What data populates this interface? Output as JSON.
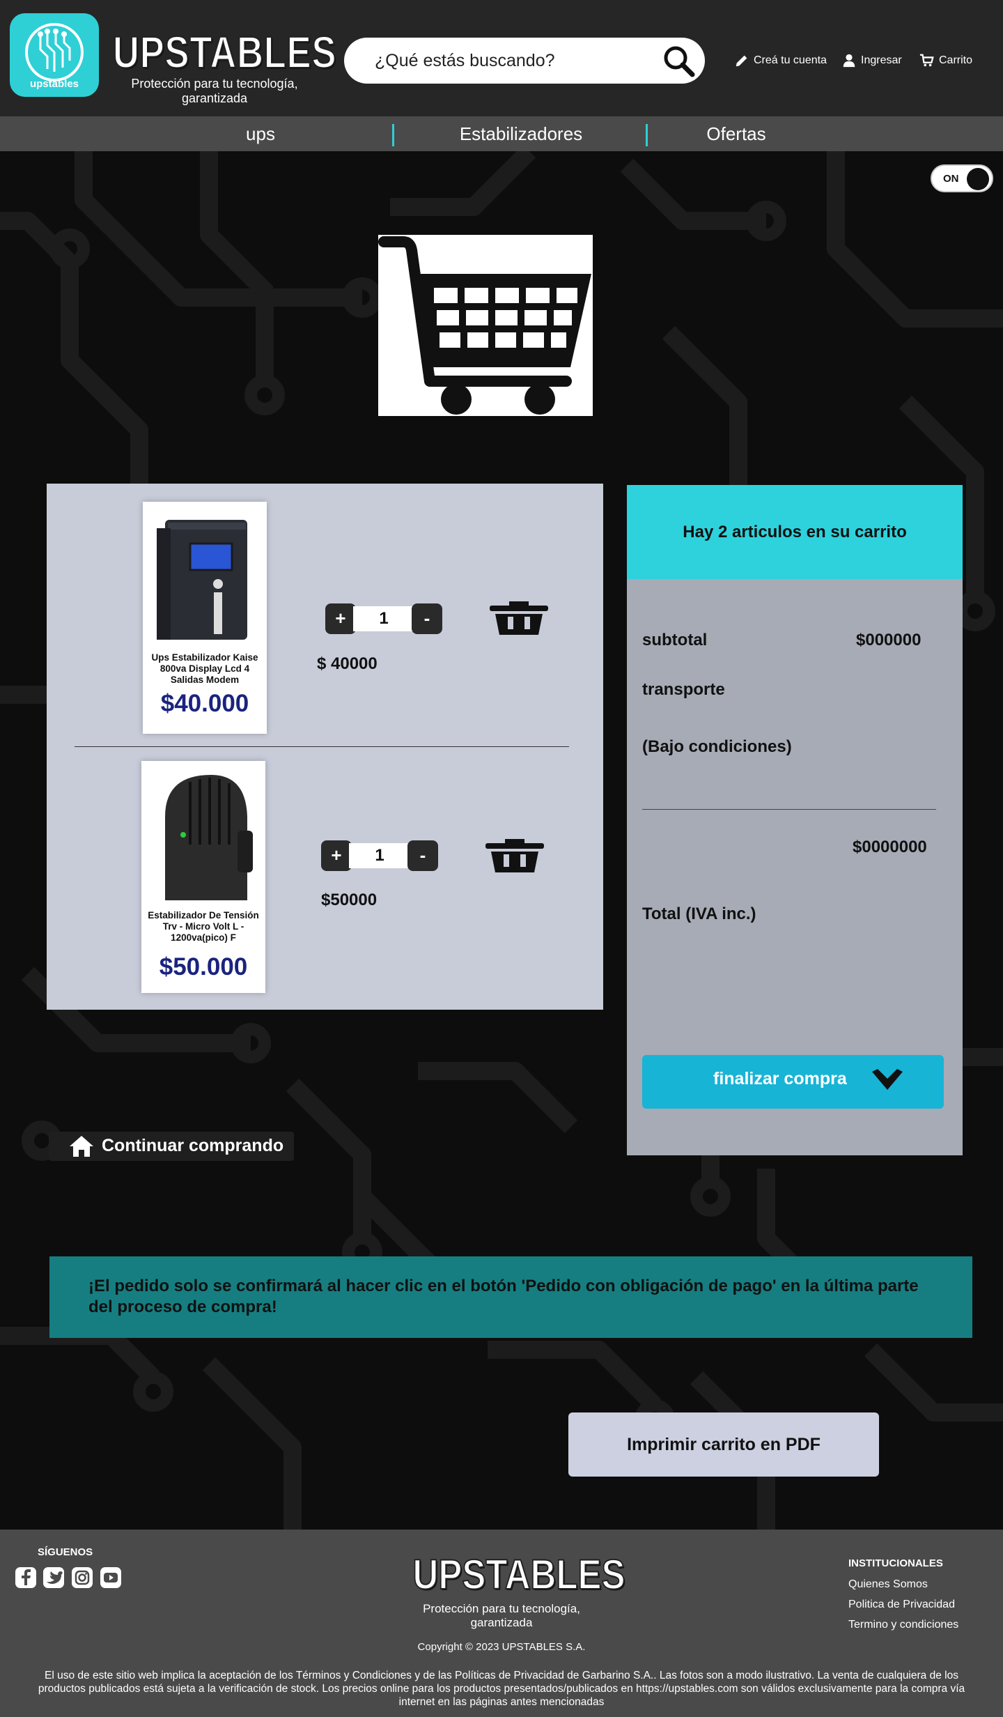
{
  "header": {
    "logo_badge_text": "upstables",
    "brand_name": "UPSTABLES",
    "tagline": "Protección para tu tecnología, garantizada",
    "search_placeholder": "¿Qué estás buscando?",
    "links": {
      "create_account": "Creá tu cuenta",
      "login": "Ingresar",
      "cart": "Carrito"
    }
  },
  "nav": {
    "items": [
      "ups",
      "Estabilizadores",
      "Ofertas"
    ]
  },
  "toggle": {
    "label": "ON",
    "state": "on"
  },
  "cart": {
    "items": [
      {
        "name": "Ups Estabilizador Kaise 800va Display Lcd 4 Salidas Modem",
        "card_price": "$40.000",
        "quantity": "1",
        "line_price": "$ 40000",
        "image": "ups-device-image"
      },
      {
        "name": "Estabilizador De Tensión Trv - Micro Volt L - 1200va(pico) F",
        "card_price": "$50.000",
        "quantity": "1",
        "line_price": "$50000",
        "image": "stabilizer-device-image"
      }
    ],
    "plus_label": "+",
    "minus_label": "-"
  },
  "summary": {
    "heading": "Hay 2 articulos en su carrito",
    "subtotal_label": "subtotal",
    "subtotal_value": "$000000",
    "transport_label": "transporte",
    "conditions_label": "(Bajo condiciones)",
    "total_value": "$0000000",
    "total_label": "Total (IVA inc.)",
    "checkout_label": "finalizar compra"
  },
  "continue_label": "Continuar comprando",
  "notice": "¡El pedido solo se confirmará al hacer clic en el botón 'Pedido con obligación de pago' en la última parte del proceso de compra!",
  "pdf_label": "Imprimir carrito en PDF",
  "footer": {
    "follow_label": "SÍGUENOS",
    "social_icons": [
      "facebook-icon",
      "twitter-icon",
      "instagram-icon",
      "youtube-icon"
    ],
    "brand_name": "UPSTABLES",
    "tagline": "Protección para tu tecnología, garantizada",
    "copyright": "Copyright © 2023 UPSTABLES S.A.",
    "institutional_title": "INSTITUCIONALES",
    "institutional_links": [
      "Quienes Somos",
      "Politica de Privacidad",
      "Termino y condiciones"
    ],
    "legal": "El uso de este sitio web implica la aceptación de los Términos y Condiciones y de las Políticas de Privacidad de Garbarino S.A.. Las fotos son a modo ilustrativo. La venta de cualquiera de los productos publicados está sujeta a la verificación de stock. Los precios online para los productos presentados/publicados en https://upstables.com  son válidos exclusivamente para la compra vía internet en las páginas antes mencionadas"
  },
  "colors": {
    "accent": "#2dd2dc",
    "header_bg": "#262626",
    "nav_bg": "#4a4a4a",
    "checkout_button": "#17b4d6",
    "notice_bg": "#167e80",
    "price_text": "#1a237e"
  }
}
